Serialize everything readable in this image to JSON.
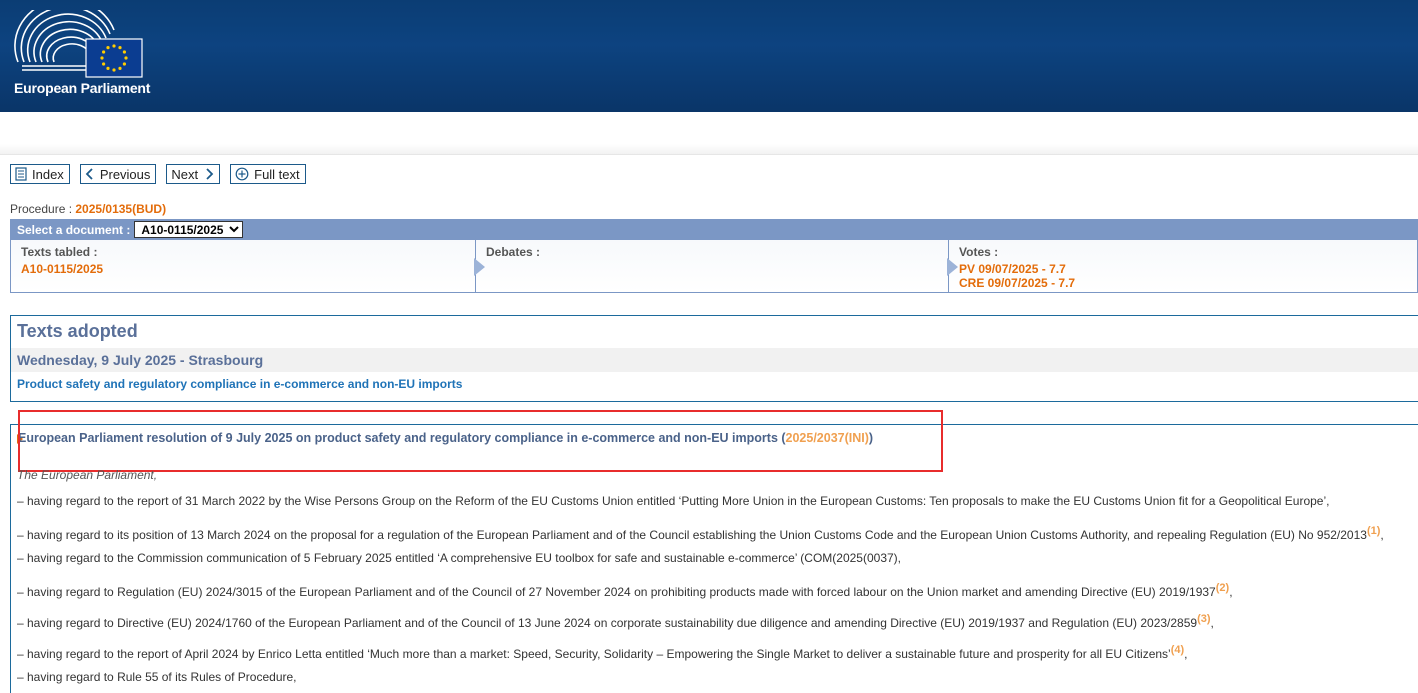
{
  "header": {
    "logo_text": "European Parliament"
  },
  "nav": {
    "index_label": "Index",
    "previous_label": "Previous",
    "next_label": "Next",
    "fulltext_label": "Full text"
  },
  "procedure": {
    "label": "Procedure : ",
    "ref": "2025/0135(BUD)"
  },
  "document_select": {
    "label": "Select a document :",
    "selected": "A10-0115/2025"
  },
  "stages": {
    "texts_tabled": {
      "title": "Texts tabled :",
      "value": "A10-0115/2025"
    },
    "debates": {
      "title": "Debates :"
    },
    "votes": {
      "title": "Votes :",
      "values": [
        "PV 09/07/2025 - 7.7",
        "CRE 09/07/2025 - 7.7"
      ]
    }
  },
  "adopted": {
    "heading": "Texts adopted",
    "date": "Wednesday, 9 July 2025 - Strasbourg",
    "subject": "Product safety and regulatory compliance in e-commerce and non-EU imports"
  },
  "resolution": {
    "title": "European Parliament resolution of 9 July 2025 on product safety and regulatory compliance in e-commerce and non-EU imports (",
    "procedure_ref": "2025/2037(INI)",
    "title_close": ")",
    "intro": "The European Parliament,",
    "citations": [
      {
        "text": "–  having regard to the report of 31 March 2022 by the Wise Persons Group on the Reform of the EU Customs Union entitled ‘Putting More Union in the European Customs: Ten proposals to make the EU Customs Union fit for a Geopolitical Europe’,",
        "note": "",
        "tail": ""
      },
      {
        "text": "–  having regard to its position of 13 March 2024 on the proposal for a regulation of the European Parliament and of the Council establishing the Union Customs Code and the European Union Customs Authority, and repealing Regulation (EU) No 952/2013",
        "note": "(1)",
        "tail": ","
      },
      {
        "text": "–  having regard to the Commission communication of 5 February 2025 entitled ‘A comprehensive EU toolbox for safe and sustainable e-commerce’ (COM(2025(0037),",
        "note": "",
        "tail": ""
      },
      {
        "text": "–  having regard to Regulation (EU) 2024/3015 of the European Parliament and of the Council of 27 November 2024 on prohibiting products made with forced labour on the Union market and amending Directive (EU) 2019/1937",
        "note": "(2)",
        "tail": ","
      },
      {
        "text": "–  having regard to Directive (EU) 2024/1760 of the European Parliament and of the Council of 13 June 2024 on corporate sustainability due diligence and amending Directive (EU) 2019/1937 and Regulation (EU) 2023/2859",
        "note": "(3)",
        "tail": ","
      },
      {
        "text": "–  having regard to the report of April 2024 by Enrico Letta entitled ‘Much more than a market: Speed, Security, Solidarity – Empowering the Single Market to deliver a sustainable future and prosperity for all EU Citizens’",
        "note": "(4)",
        "tail": ","
      },
      {
        "text": "–  having regard to Rule 55 of its Rules of Procedure,",
        "note": "",
        "tail": ""
      }
    ]
  }
}
